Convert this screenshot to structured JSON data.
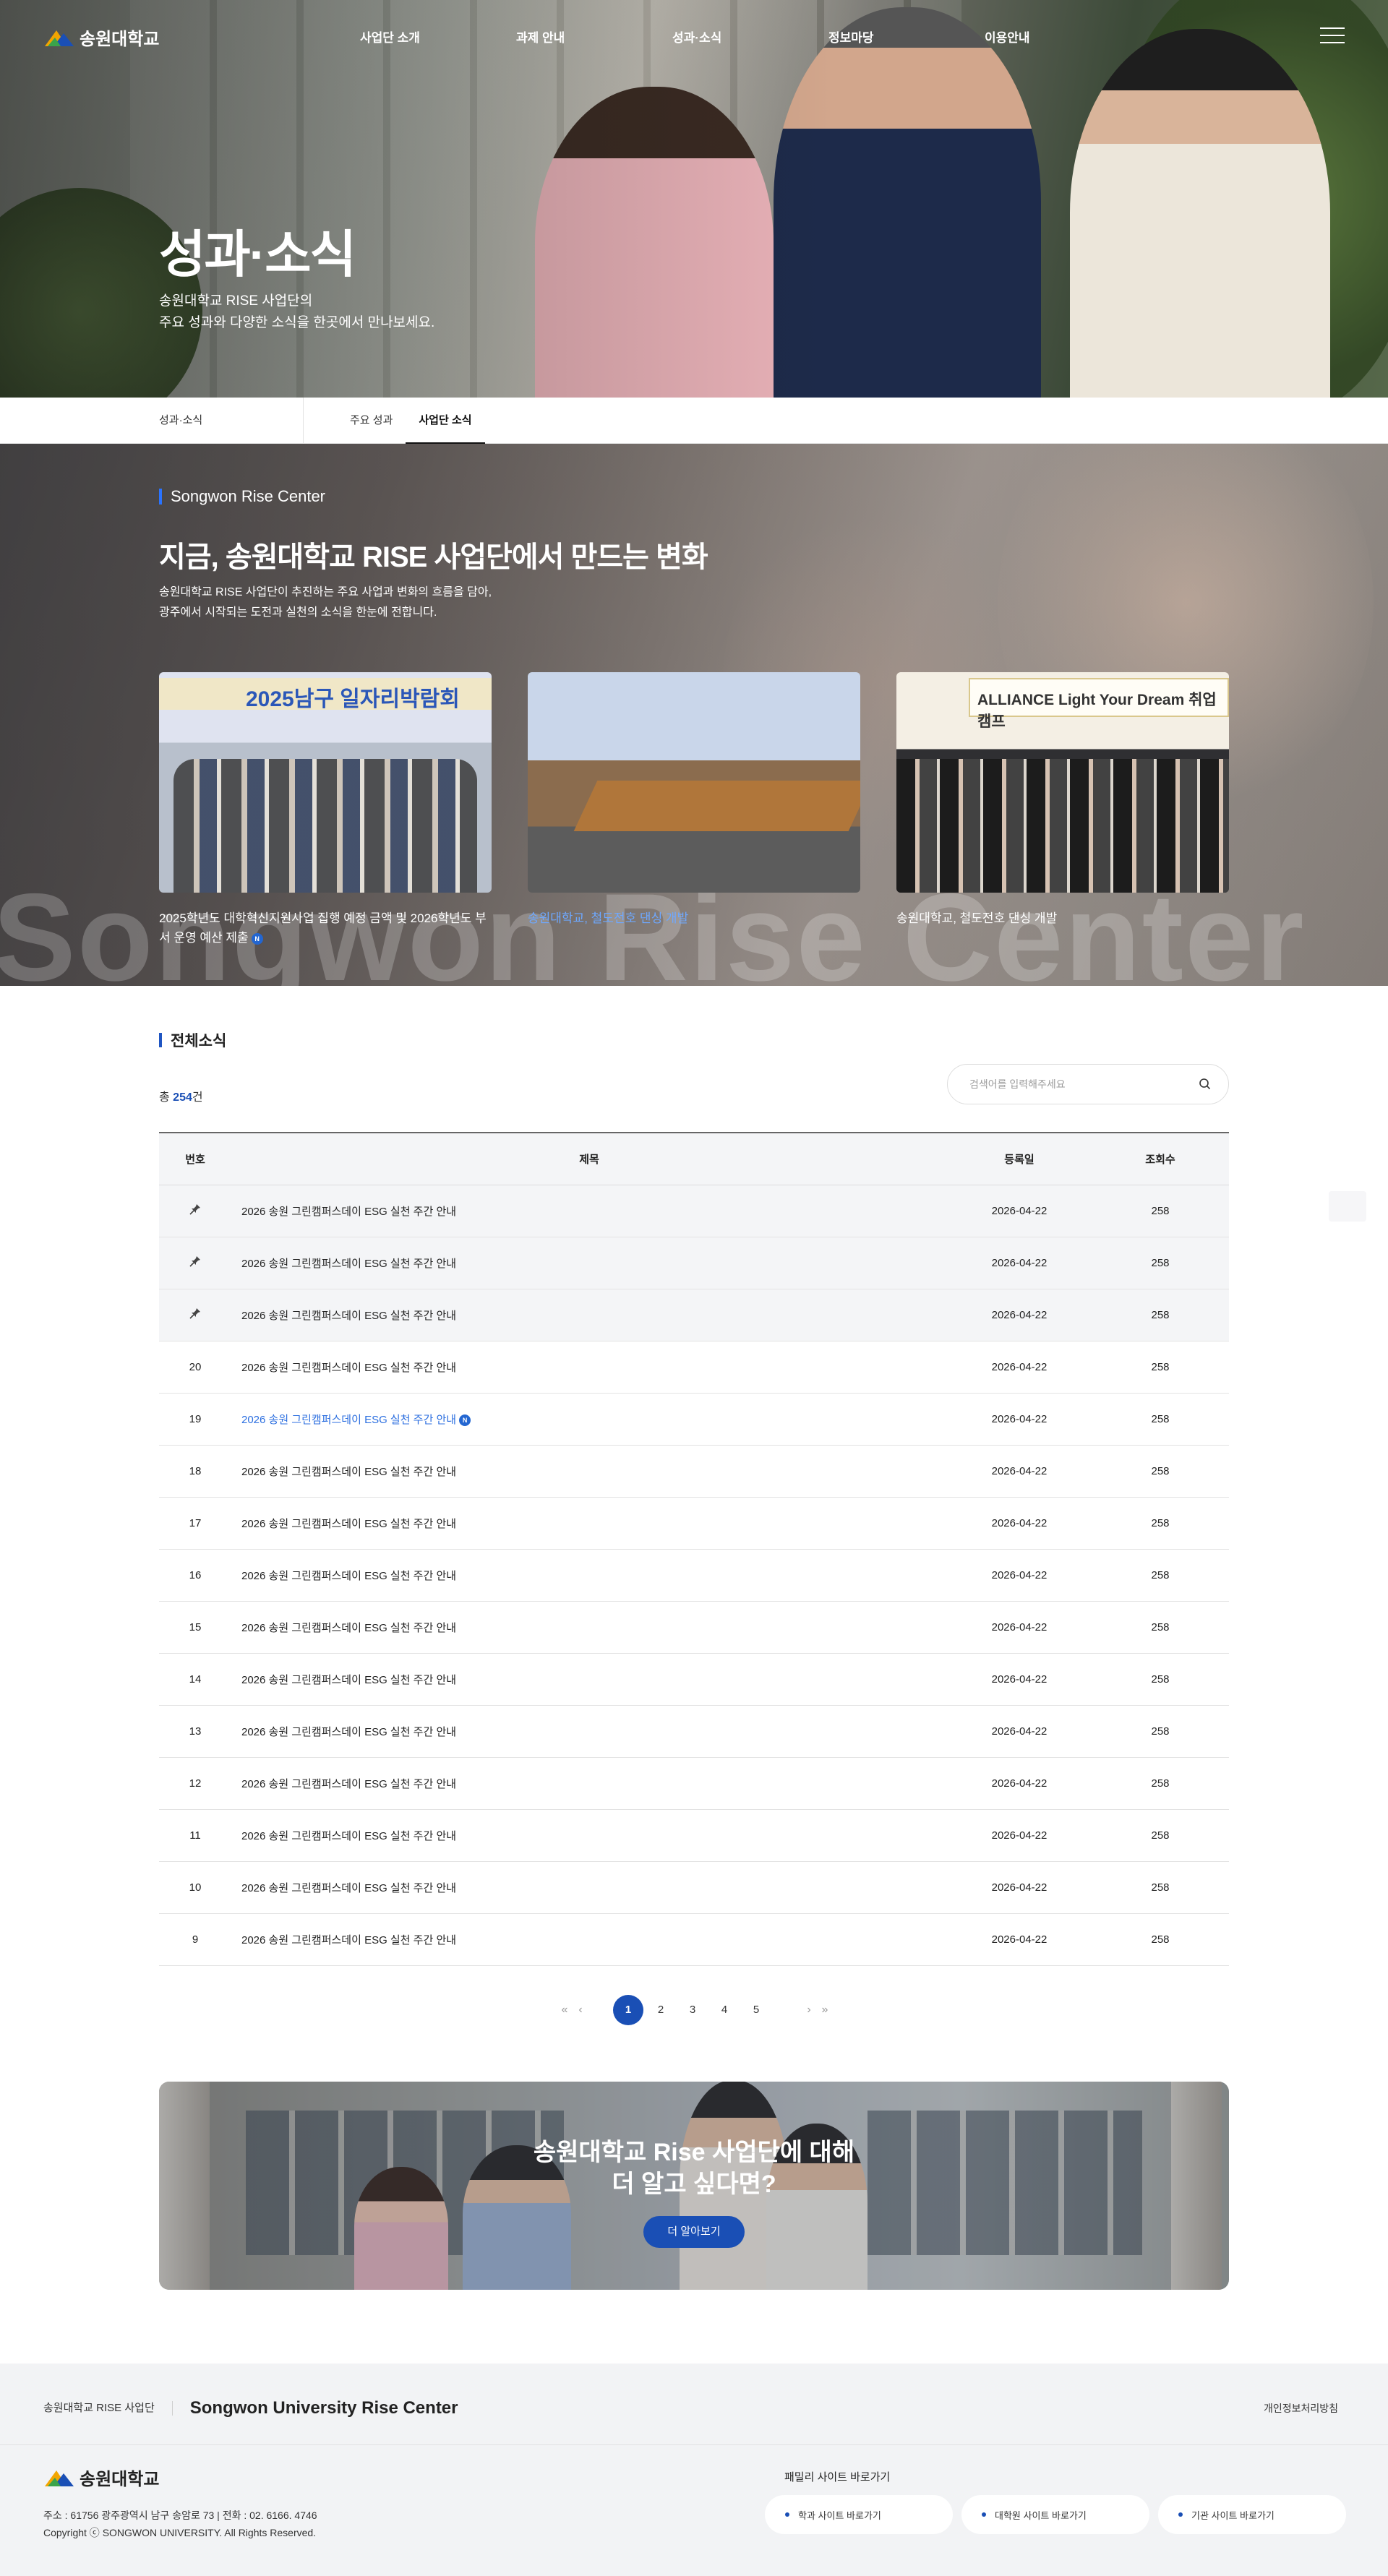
{
  "header": {
    "logo_text": "송원대학교",
    "nav": [
      "사업단 소개",
      "과제 안내",
      "성과·소식",
      "정보마당",
      "이용안내"
    ]
  },
  "hero": {
    "title": "성과·소식",
    "desc": "송원대학교 RISE 사업단의\n주요 성과와 다양한 소식을 한곳에서 만나보세요."
  },
  "subnav": {
    "crumb": "성과·소식",
    "tabs": [
      "주요 성과",
      "사업단 소식"
    ],
    "active_tab": "사업단 소식"
  },
  "news": {
    "eyebrow": "Songwon Rise Center",
    "title": "지금, 송원대학교 RISE 사업단에서 만드는 변화",
    "desc": "송원대학교 RISE 사업단이 추진하는 주요 사업과 변화의 흐름을 담아,\n광주에서 시작되는 도전과 실천의 소식을 한눈에 전합니다.",
    "watermark": "Songwon Rise Center",
    "cards": [
      {
        "caption": "2025학년도 대학혁신지원사업 집행 예정 금액 및 2026학년도 부서 운영 예산 제출",
        "new_badge": "N",
        "photo_text": "2025남구 일자리박람회"
      },
      {
        "caption": "송원대학교, 철도전호 댄싱 개발"
      },
      {
        "caption": "송원대학교, 철도전호 댄싱 개발",
        "photo_text": "ALLIANCE Light Your Dream 취업캠프"
      }
    ]
  },
  "board": {
    "heading": "전체소식",
    "total_prefix": "총 ",
    "total_count": "254",
    "total_suffix": "건",
    "search_placeholder": "검색어를 입력해주세요",
    "columns": [
      "번호",
      "제목",
      "등록일",
      "조회수"
    ],
    "rows": [
      {
        "no": "",
        "pinned": true,
        "title": "2026 송원 그린캠퍼스데이 ESG 실천 주간 안내",
        "date": "2026-04-22",
        "views": "258"
      },
      {
        "no": "",
        "pinned": true,
        "title": "2026 송원 그린캠퍼스데이 ESG 실천 주간 안내",
        "date": "2026-04-22",
        "views": "258"
      },
      {
        "no": "",
        "pinned": true,
        "title": "2026 송원 그린캠퍼스데이 ESG 실천 주간 안내",
        "date": "2026-04-22",
        "views": "258"
      },
      {
        "no": "20",
        "title": "2026 송원 그린캠퍼스데이 ESG 실천 주간 안내",
        "date": "2026-04-22",
        "views": "258"
      },
      {
        "no": "19",
        "title": "2026 송원 그린캠퍼스데이 ESG 실천 주간 안내",
        "date": "2026-04-22",
        "views": "258",
        "highlight": true,
        "new_badge": "N"
      },
      {
        "no": "18",
        "title": "2026 송원 그린캠퍼스데이 ESG 실천 주간 안내",
        "date": "2026-04-22",
        "views": "258"
      },
      {
        "no": "17",
        "title": "2026 송원 그린캠퍼스데이 ESG 실천 주간 안내",
        "date": "2026-04-22",
        "views": "258"
      },
      {
        "no": "16",
        "title": "2026 송원 그린캠퍼스데이 ESG 실천 주간 안내",
        "date": "2026-04-22",
        "views": "258"
      },
      {
        "no": "15",
        "title": "2026 송원 그린캠퍼스데이 ESG 실천 주간 안내",
        "date": "2026-04-22",
        "views": "258"
      },
      {
        "no": "14",
        "title": "2026 송원 그린캠퍼스데이 ESG 실천 주간 안내",
        "date": "2026-04-22",
        "views": "258"
      },
      {
        "no": "13",
        "title": "2026 송원 그린캠퍼스데이 ESG 실천 주간 안내",
        "date": "2026-04-22",
        "views": "258"
      },
      {
        "no": "12",
        "title": "2026 송원 그린캠퍼스데이 ESG 실천 주간 안내",
        "date": "2026-04-22",
        "views": "258"
      },
      {
        "no": "11",
        "title": "2026 송원 그린캠퍼스데이 ESG 실천 주간 안내",
        "date": "2026-04-22",
        "views": "258"
      },
      {
        "no": "10",
        "title": "2026 송원 그린캠퍼스데이 ESG 실천 주간 안내",
        "date": "2026-04-22",
        "views": "258"
      },
      {
        "no": "9",
        "title": "2026 송원 그린캠퍼스데이 ESG 실천 주간 안내",
        "date": "2026-04-22",
        "views": "258"
      }
    ],
    "pages": [
      "1",
      "2",
      "3",
      "4",
      "5"
    ],
    "current_page": "1"
  },
  "cta": {
    "title": "송원대학교 Rise 사업단에 대해\n더 알고 싶다면?",
    "button": "더 알아보기"
  },
  "footer": {
    "org": "송원대학교 RISE 사업단",
    "org_en": "Songwon University Rise Center",
    "privacy": "개인정보처리방침",
    "logo_text": "송원대학교",
    "address": "주소 : 61756 광주광역시 남구 송암로 73   |   전화 : 02. 6166. 4746",
    "copyright": "Copyright ⓒ SONGWON UNIVERSITY. All Rights Reserved.",
    "family_label": "패밀리 사이트 바로가기",
    "family_links": [
      "학과 사이트 바로가기",
      "대학원 사이트 바로가기",
      "기관 사이트 바로가기"
    ]
  },
  "colors": {
    "primary": "#1a4fb5",
    "link_highlight": "#2c6fe0",
    "accent_bar": "#2a73ff"
  }
}
